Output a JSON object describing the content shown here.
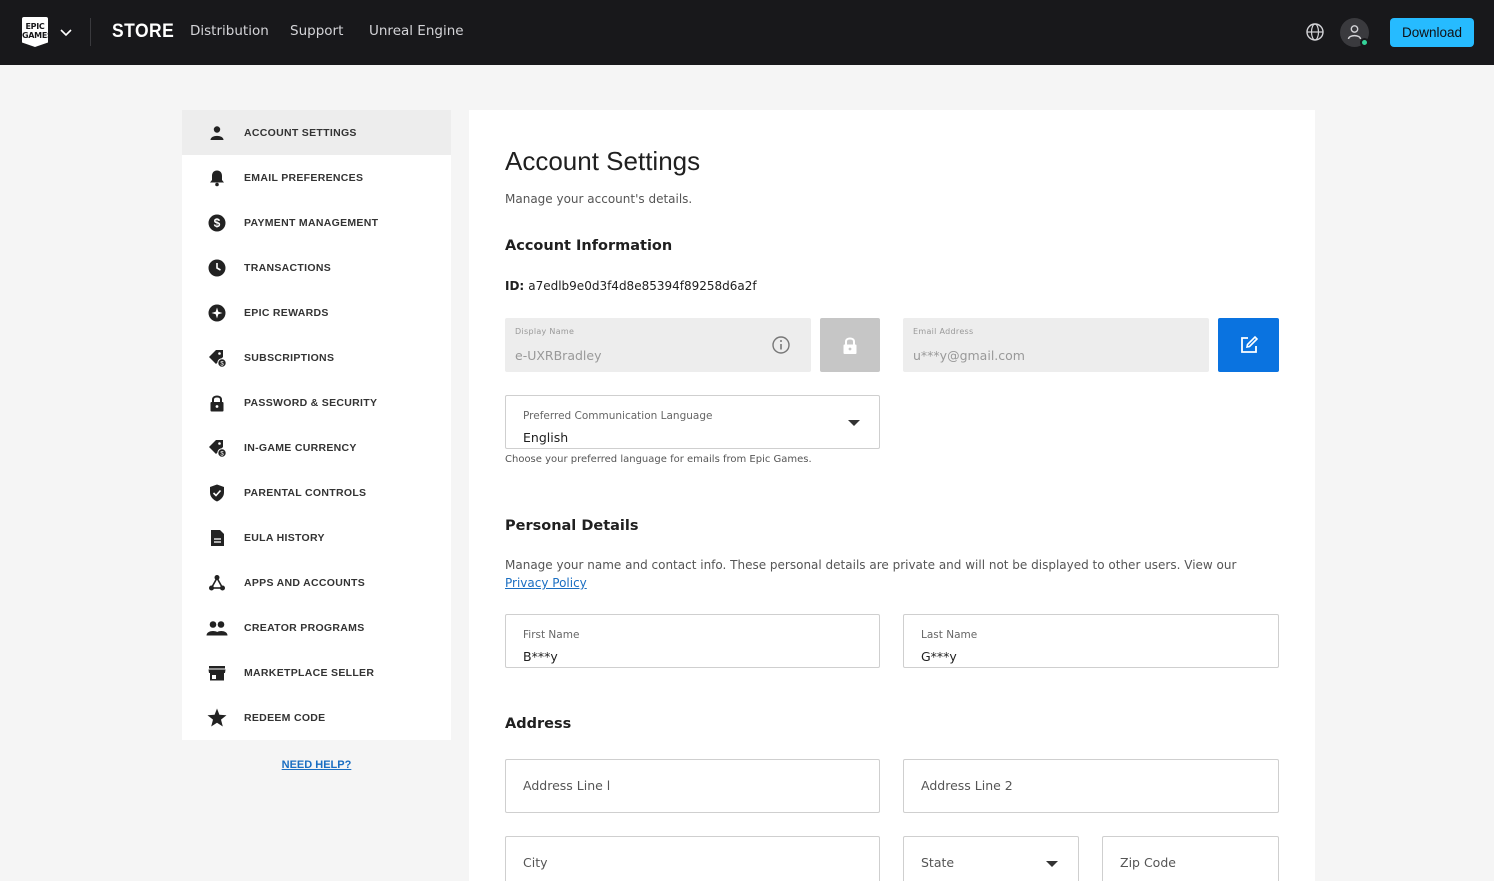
{
  "topbar": {
    "logo_text": "EPIC GAMES",
    "store_label": "STORE",
    "nav": [
      "Distribution",
      "Support",
      "Unreal Engine"
    ],
    "download_label": "Download"
  },
  "sidebar": {
    "items": [
      {
        "label": "ACCOUNT SETTINGS",
        "icon": "person-icon",
        "active": true
      },
      {
        "label": "EMAIL PREFERENCES",
        "icon": "bell-icon"
      },
      {
        "label": "PAYMENT MANAGEMENT",
        "icon": "dollar-icon"
      },
      {
        "label": "TRANSACTIONS",
        "icon": "clock-icon"
      },
      {
        "label": "EPIC REWARDS",
        "icon": "rewards-icon"
      },
      {
        "label": "SUBSCRIPTIONS",
        "icon": "tag-icon"
      },
      {
        "label": "PASSWORD & SECURITY",
        "icon": "lock-icon"
      },
      {
        "label": "IN-GAME CURRENCY",
        "icon": "tag-icon"
      },
      {
        "label": "PARENTAL CONTROLS",
        "icon": "shield-icon"
      },
      {
        "label": "EULA HISTORY",
        "icon": "document-icon"
      },
      {
        "label": "APPS AND ACCOUNTS",
        "icon": "apps-icon"
      },
      {
        "label": "CREATOR PROGRAMS",
        "icon": "people-icon"
      },
      {
        "label": "MARKETPLACE SELLER",
        "icon": "store-icon"
      },
      {
        "label": "REDEEM CODE",
        "icon": "star-icon"
      }
    ],
    "need_help": "NEED HELP?"
  },
  "main": {
    "title": "Account Settings",
    "subtitle": "Manage your account's details.",
    "account_info": {
      "heading": "Account Information",
      "id_label": "ID:",
      "id_value": "a7edlb9e0d3f4d8e85394f89258d6a2f",
      "display_name_label": "Display Name",
      "display_name_value": "e-UXRBradley",
      "email_label": "Email Address",
      "email_value": "u***y@gmail.com",
      "language_label": "Preferred Communication Language",
      "language_value": "English",
      "language_helper": "Choose your preferred language for emails from Epic Games."
    },
    "personal": {
      "heading": "Personal Details",
      "description": "Manage your name and contact info. These personal details are private and will not be displayed to other users. View our ",
      "privacy_link": "Privacy Policy",
      "first_name_label": "First Name",
      "first_name_value": "B***y",
      "last_name_label": "Last Name",
      "last_name_value": "G***y"
    },
    "address": {
      "heading": "Address",
      "line1_placeholder": "Address Line l",
      "line2_placeholder": "Address Line 2",
      "city_placeholder": "City",
      "state_placeholder": "State",
      "zip_placeholder": "Zip Code"
    }
  },
  "colors": {
    "topbar_bg": "#18181b",
    "download_btn": "#26bbff",
    "edit_btn": "#0a73e0",
    "link": "#1a6ec2"
  }
}
